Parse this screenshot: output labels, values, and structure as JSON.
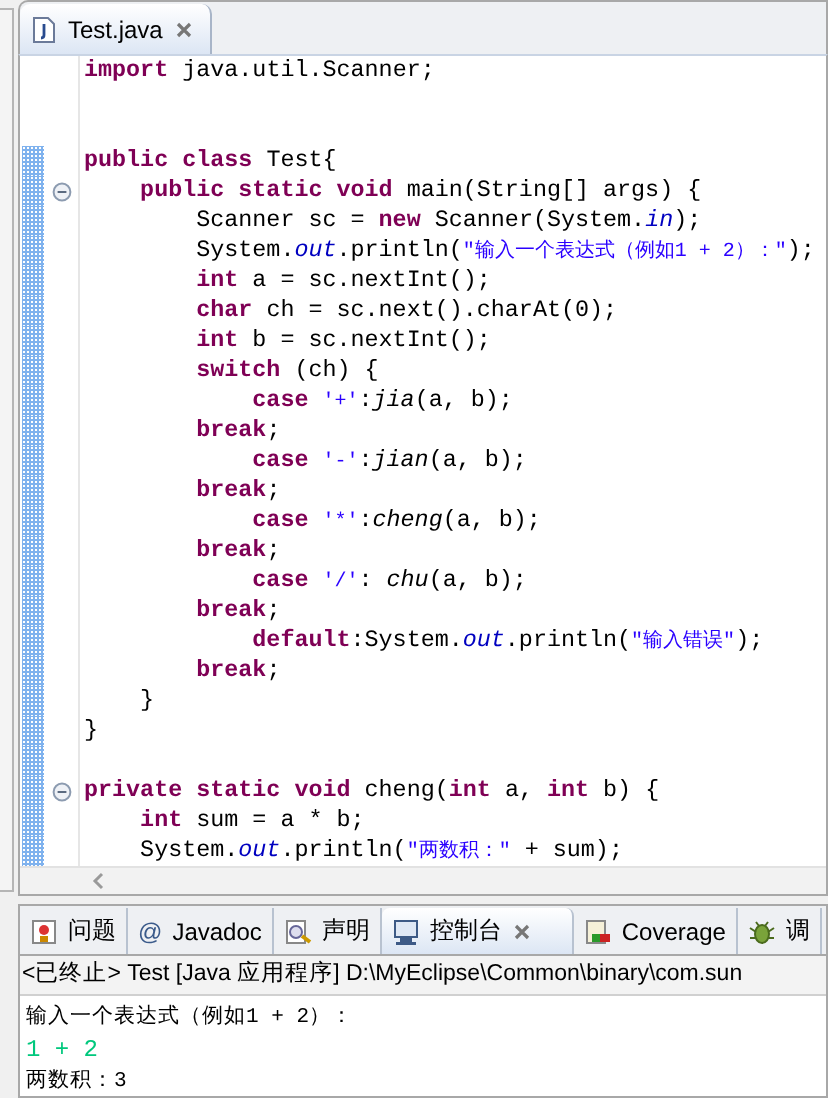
{
  "editor_tabs": [
    {
      "label": "Test.java",
      "selected": true,
      "closable": true
    }
  ],
  "code_lines": [
    {
      "kind": "code",
      "changed": false,
      "foldable": false,
      "tokens": [
        {
          "kind": "kw",
          "text": "import "
        },
        {
          "kind": "plain",
          "text": "java.util.Scanner;"
        }
      ]
    },
    {
      "kind": "blank",
      "changed": false,
      "foldable": false
    },
    {
      "kind": "blank",
      "changed": false,
      "foldable": false
    },
    {
      "kind": "code",
      "changed": true,
      "foldable": false,
      "tokens": [
        {
          "kind": "kw",
          "text": "public class "
        },
        {
          "kind": "plain",
          "text": "Test{"
        }
      ]
    },
    {
      "kind": "code",
      "changed": true,
      "foldable": true,
      "tokens": [
        {
          "kind": "kw",
          "text": "    public static void "
        },
        {
          "kind": "plain",
          "text": "main(String[] args) {"
        }
      ]
    },
    {
      "kind": "code",
      "changed": true,
      "foldable": false,
      "tokens": [
        {
          "kind": "plain",
          "text": "        Scanner sc = "
        },
        {
          "kind": "kw",
          "text": "new "
        },
        {
          "kind": "plain",
          "text": "Scanner(System."
        },
        {
          "kind": "field",
          "text": "in"
        },
        {
          "kind": "plain",
          "text": ");"
        }
      ]
    },
    {
      "kind": "code",
      "changed": true,
      "foldable": false,
      "tokens": [
        {
          "kind": "plain",
          "text": "        System."
        },
        {
          "kind": "field",
          "text": "out"
        },
        {
          "kind": "plain",
          "text": ".println("
        },
        {
          "kind": "str",
          "text": "\"输入一个表达式（例如1 + 2）：\""
        },
        {
          "kind": "plain",
          "text": ");"
        }
      ]
    },
    {
      "kind": "code",
      "changed": true,
      "foldable": false,
      "tokens": [
        {
          "kind": "kw",
          "text": "        int "
        },
        {
          "kind": "plain",
          "text": "a = sc.nextInt();"
        }
      ]
    },
    {
      "kind": "code",
      "changed": true,
      "foldable": false,
      "tokens": [
        {
          "kind": "kw",
          "text": "        char "
        },
        {
          "kind": "plain",
          "text": "ch = sc.next().charAt(0);"
        }
      ]
    },
    {
      "kind": "code",
      "changed": true,
      "foldable": false,
      "tokens": [
        {
          "kind": "kw",
          "text": "        int "
        },
        {
          "kind": "plain",
          "text": "b = sc.nextInt();"
        }
      ]
    },
    {
      "kind": "code",
      "changed": true,
      "foldable": false,
      "tokens": [
        {
          "kind": "kw",
          "text": "        switch "
        },
        {
          "kind": "plain",
          "text": "(ch) {"
        }
      ]
    },
    {
      "kind": "code",
      "changed": true,
      "foldable": false,
      "tokens": [
        {
          "kind": "kw",
          "text": "            case "
        },
        {
          "kind": "str",
          "text": "'+'"
        },
        {
          "kind": "plain",
          "text": ":"
        },
        {
          "kind": "call",
          "text": "jia"
        },
        {
          "kind": "plain",
          "text": "(a, b);"
        }
      ]
    },
    {
      "kind": "code",
      "changed": true,
      "foldable": false,
      "tokens": [
        {
          "kind": "kw",
          "text": "        break"
        },
        {
          "kind": "plain",
          "text": ";"
        }
      ]
    },
    {
      "kind": "code",
      "changed": true,
      "foldable": false,
      "tokens": [
        {
          "kind": "kw",
          "text": "            case "
        },
        {
          "kind": "str",
          "text": "'-'"
        },
        {
          "kind": "plain",
          "text": ":"
        },
        {
          "kind": "call",
          "text": "jian"
        },
        {
          "kind": "plain",
          "text": "(a, b);"
        }
      ]
    },
    {
      "kind": "code",
      "changed": true,
      "foldable": false,
      "tokens": [
        {
          "kind": "kw",
          "text": "        break"
        },
        {
          "kind": "plain",
          "text": ";"
        }
      ]
    },
    {
      "kind": "code",
      "changed": true,
      "foldable": false,
      "tokens": [
        {
          "kind": "kw",
          "text": "            case "
        },
        {
          "kind": "str",
          "text": "'*'"
        },
        {
          "kind": "plain",
          "text": ":"
        },
        {
          "kind": "call",
          "text": "cheng"
        },
        {
          "kind": "plain",
          "text": "(a, b);"
        }
      ]
    },
    {
      "kind": "code",
      "changed": true,
      "foldable": false,
      "tokens": [
        {
          "kind": "kw",
          "text": "        break"
        },
        {
          "kind": "plain",
          "text": ";"
        }
      ]
    },
    {
      "kind": "code",
      "changed": true,
      "foldable": false,
      "tokens": [
        {
          "kind": "kw",
          "text": "            case "
        },
        {
          "kind": "str",
          "text": "'/'"
        },
        {
          "kind": "plain",
          "text": ": "
        },
        {
          "kind": "call",
          "text": "chu"
        },
        {
          "kind": "plain",
          "text": "(a, b);"
        }
      ]
    },
    {
      "kind": "code",
      "changed": true,
      "foldable": false,
      "tokens": [
        {
          "kind": "kw",
          "text": "        break"
        },
        {
          "kind": "plain",
          "text": ";"
        }
      ]
    },
    {
      "kind": "code",
      "changed": true,
      "foldable": false,
      "tokens": [
        {
          "kind": "kw",
          "text": "            default"
        },
        {
          "kind": "plain",
          "text": ":System."
        },
        {
          "kind": "field",
          "text": "out"
        },
        {
          "kind": "plain",
          "text": ".println("
        },
        {
          "kind": "str",
          "text": "\"输入错误\""
        },
        {
          "kind": "plain",
          "text": ");"
        }
      ]
    },
    {
      "kind": "code",
      "changed": true,
      "foldable": false,
      "tokens": [
        {
          "kind": "kw",
          "text": "        break"
        },
        {
          "kind": "plain",
          "text": ";"
        }
      ]
    },
    {
      "kind": "code",
      "changed": true,
      "foldable": false,
      "tokens": [
        {
          "kind": "plain",
          "text": "    }"
        }
      ]
    },
    {
      "kind": "code",
      "changed": true,
      "foldable": false,
      "tokens": [
        {
          "kind": "plain",
          "text": "}"
        }
      ]
    },
    {
      "kind": "blank",
      "changed": true,
      "foldable": false
    },
    {
      "kind": "code",
      "changed": true,
      "foldable": true,
      "tokens": [
        {
          "kind": "kw",
          "text": "private static void "
        },
        {
          "kind": "plain",
          "text": "cheng("
        },
        {
          "kind": "kw",
          "text": "int "
        },
        {
          "kind": "plain",
          "text": "a, "
        },
        {
          "kind": "kw",
          "text": "int "
        },
        {
          "kind": "plain",
          "text": "b) {"
        }
      ]
    },
    {
      "kind": "code",
      "changed": true,
      "foldable": false,
      "tokens": [
        {
          "kind": "kw",
          "text": "    int "
        },
        {
          "kind": "plain",
          "text": "sum = a * b;"
        }
      ]
    },
    {
      "kind": "code",
      "changed": true,
      "foldable": false,
      "tokens": [
        {
          "kind": "plain",
          "text": "    System."
        },
        {
          "kind": "field",
          "text": "out"
        },
        {
          "kind": "plain",
          "text": ".println("
        },
        {
          "kind": "str",
          "text": "\"两数积：\""
        },
        {
          "kind": "plain",
          "text": " + sum);"
        }
      ]
    }
  ],
  "bottom_tabs": [
    {
      "label": "问题",
      "selected": false,
      "closable": false
    },
    {
      "label": "Javadoc",
      "glyph": "@",
      "selected": false,
      "closable": false
    },
    {
      "label": "声明",
      "selected": false,
      "closable": false
    },
    {
      "label": "控制台",
      "selected": true,
      "closable": true
    },
    {
      "label": "Coverage",
      "selected": false,
      "closable": false
    },
    {
      "label": "调",
      "selected": false,
      "closable": false
    }
  ],
  "console": {
    "header": "<已终止> Test [Java 应用程序] D:\\MyEclipse\\Common\\binary\\com.sun",
    "output": [
      {
        "kind": "output",
        "text": "输入一个表达式（例如1 + 2）："
      },
      {
        "kind": "input",
        "text": "1 + 2"
      },
      {
        "kind": "output",
        "text": "两数积：3"
      }
    ]
  }
}
